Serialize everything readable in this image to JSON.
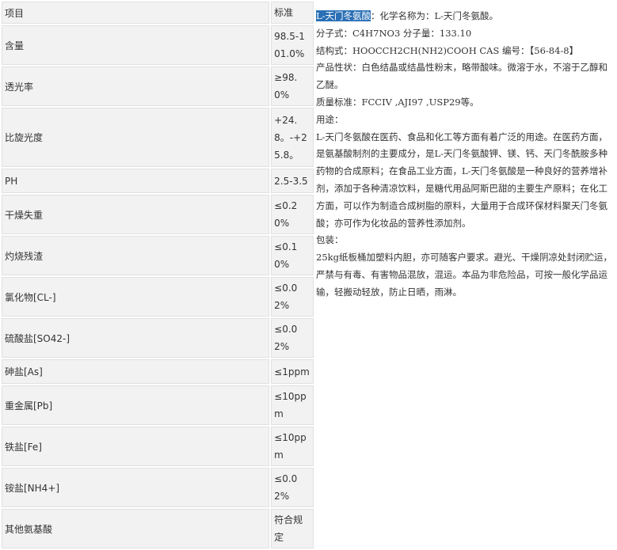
{
  "table": {
    "header": [
      "项目",
      "标准"
    ],
    "rows": [
      {
        "item": "含量",
        "standard": "98.5-101.0%"
      },
      {
        "item": "透光率",
        "standard": "≥98.0%"
      },
      {
        "item": "比旋光度",
        "standard": "+24.8。-+25.8。"
      },
      {
        "item": "PH",
        "standard": "2.5-3.5"
      },
      {
        "item": "干燥失重",
        "standard": "≤0.20%"
      },
      {
        "item": "灼烧残渣",
        "standard": "≤0.10%"
      },
      {
        "item": "氯化物[CL-]",
        "standard": "≤0.02%"
      },
      {
        "item": "硫酸盐[SO42-]",
        "standard": "≤0.02%"
      },
      {
        "item": "砷盐[As]",
        "standard": "≤1ppm"
      },
      {
        "item": "重金属[Pb]",
        "standard": "≤10ppm"
      },
      {
        "item": "铁盐[Fe]",
        "standard": "≤10ppm"
      },
      {
        "item": "铵盐[NH4+]",
        "standard": "≤0.02%"
      },
      {
        "item": "其他氨基酸",
        "standard": "符合规定"
      }
    ]
  },
  "description": {
    "selected_link": "L-天门冬氨酸",
    "name_line_rest": "：化学名称为：L-天门冬氨酸。",
    "formula_line": "分子式：C4H7NO3 分子量：133.10",
    "structure_line": "结构式：HOOCCH2CH(NH2)COOH CAS 编号：【56-84-8】",
    "properties": "产品性状：白色结晶或结晶性粉末，略带酸味。微溶于水，不溶于乙醇和乙醚。",
    "quality": "质量标准：FCCIV ,AJI97 ,USP29等。",
    "usage_title": "用途：",
    "usage": "L-天门冬氨酸在医药、食品和化工等方面有着广泛的用途。在医药方面，是氨基酸制剂的主要成分，是L-天门冬氨酸钾、镁、钙、天门冬酰胺多种药物的合成原料；在食品工业方面，L-天门冬氨酸是一种良好的营养增补剂，添加于各种清凉饮料，是糖代用品阿斯巴甜的主要生产原料；在化工方面，可以作为制造合成树脂的原料，大量用于合成环保材料聚天门冬氨酸；亦可作为化妆品的营养性添加剂。",
    "packing_title": "包装：",
    "packing": "25kg纸板桶加塑料内胆，亦可随客户要求。避光、干燥阴凉处封闭贮运，严禁与有毒、有害物品混放，混运。本品为非危险品，可按一般化学品运输，轻搬动轻放，防止日晒，雨淋。"
  },
  "colors": {
    "cell_bg": "#f2f2f2",
    "highlight": "#2a6fb5",
    "text": "#333333"
  }
}
